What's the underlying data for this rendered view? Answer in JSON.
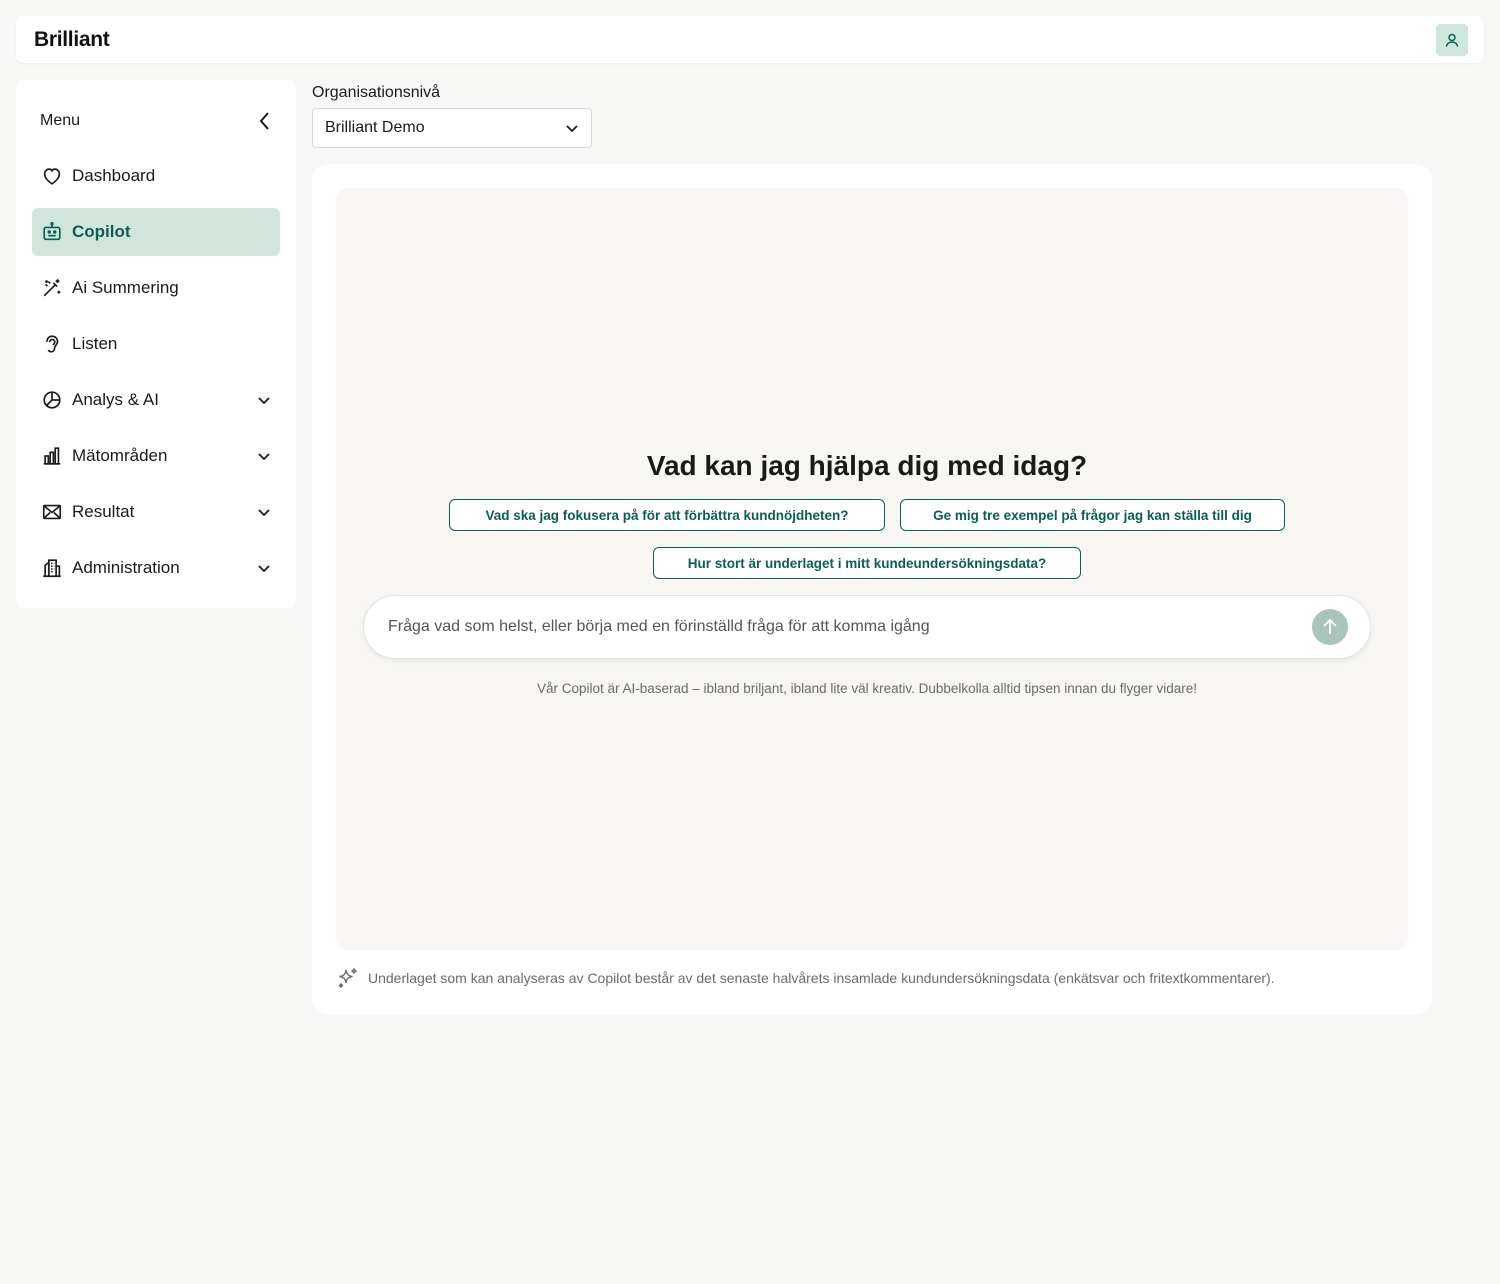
{
  "app": {
    "logo_text": "Brilliant"
  },
  "header": {
    "user_icon": "user-icon"
  },
  "sidebar": {
    "menu_label": "Menu",
    "items": [
      {
        "label": "Dashboard",
        "icon": "heart-icon",
        "active": false,
        "expandable": false
      },
      {
        "label": "Copilot",
        "icon": "robot-icon",
        "active": true,
        "expandable": false
      },
      {
        "label": "Ai Summering",
        "icon": "magic-wand-icon",
        "active": false,
        "expandable": false
      },
      {
        "label": "Listen",
        "icon": "ear-icon",
        "active": false,
        "expandable": false
      },
      {
        "label": "Analys & AI",
        "icon": "pie-chart-icon",
        "active": false,
        "expandable": true
      },
      {
        "label": "Mätområden",
        "icon": "bar-chart-icon",
        "active": false,
        "expandable": true
      },
      {
        "label": "Resultat",
        "icon": "envelope-icon",
        "active": false,
        "expandable": true
      },
      {
        "label": "Administration",
        "icon": "building-icon",
        "active": false,
        "expandable": true
      }
    ]
  },
  "org": {
    "label": "Organisationsnivå",
    "selected": "Brilliant Demo"
  },
  "copilot": {
    "heading": "Vad kan jag hjälpa dig med idag?",
    "suggestions": [
      "Vad ska jag fokusera på för att förbättra kundnöjdheten?",
      "Ge mig tre exempel på frågor jag kan ställa till dig",
      "Hur stort är underlaget i mitt kundeundersökningsdata?"
    ],
    "input_placeholder": "Fråga vad som helst, eller börja med en förinställd fråga för att komma igång",
    "disclaimer": "Vår Copilot är AI-baserad – ibland briljant, ibland lite väl kreativ. Dubbelkolla alltid tipsen innan du flyger vidare!",
    "footnote": "Underlaget som kan analyseras av Copilot består av det senaste halvårets insamlade kundundersökningsdata (enkätsvar och fritextkommentarer)."
  },
  "colors": {
    "accent": "#0c5e55",
    "active_bg": "#d0e6dc",
    "send_btn": "#a9c4bd"
  }
}
